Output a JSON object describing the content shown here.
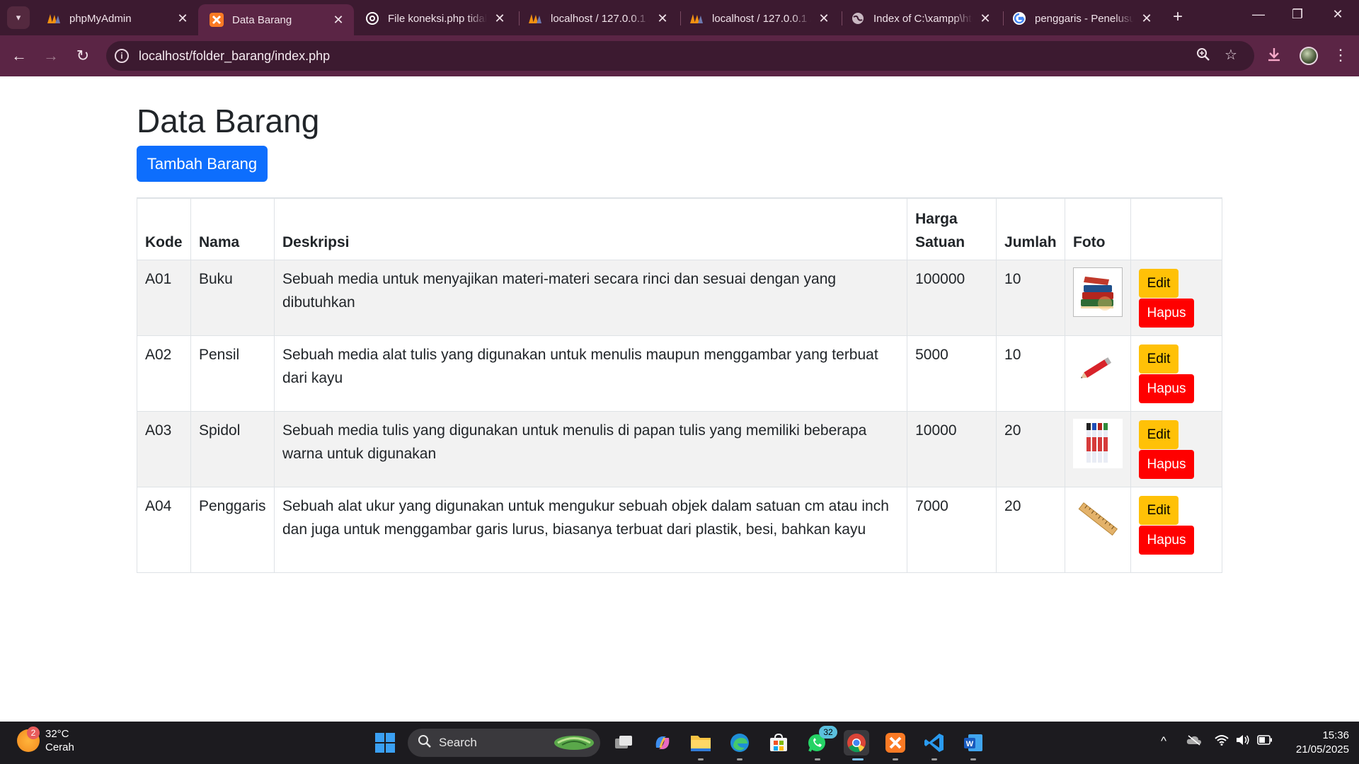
{
  "browser": {
    "tabs": [
      {
        "title": "phpMyAdmin",
        "favicon": "phpmyadmin-icon",
        "active": false
      },
      {
        "title": "Data Barang",
        "favicon": "xampp-icon",
        "active": true
      },
      {
        "title": "File koneksi.php tidak",
        "favicon": "chatgpt-icon",
        "active": false
      },
      {
        "title": "localhost / 127.0.0.1 /",
        "favicon": "phpmyadmin-icon",
        "active": false
      },
      {
        "title": "localhost / 127.0.0.1 /",
        "favicon": "phpmyadmin-icon",
        "active": false
      },
      {
        "title": "Index of C:\\xampp\\htd",
        "favicon": "globe-icon",
        "active": false
      },
      {
        "title": "penggaris - Penelusur",
        "favicon": "google-icon",
        "active": false
      }
    ],
    "url": "localhost/folder_barang/index.php"
  },
  "page": {
    "title": "Data Barang",
    "add_button": "Tambah Barang",
    "table": {
      "headers": {
        "kode": "Kode",
        "nama": "Nama",
        "deskripsi": "Deskripsi",
        "harga_line1": "Harga",
        "harga_line2": "Satuan",
        "jumlah": "Jumlah",
        "foto": "Foto"
      },
      "rows": [
        {
          "kode": "A01",
          "nama": "Buku",
          "deskripsi": "Sebuah media untuk menyajikan materi-materi secara rinci dan sesuai dengan yang dibutuhkan",
          "harga": "100000",
          "jumlah": "10",
          "foto": "books-image"
        },
        {
          "kode": "A02",
          "nama": "Pensil",
          "deskripsi": "Sebuah media alat tulis yang digunakan untuk menulis maupun menggambar yang terbuat dari kayu",
          "harga": "5000",
          "jumlah": "10",
          "foto": "pencil-image"
        },
        {
          "kode": "A03",
          "nama": "Spidol",
          "deskripsi": "Sebuah media tulis yang digunakan untuk menulis di papan tulis yang memiliki beberapa warna untuk digunakan",
          "harga": "10000",
          "jumlah": "20",
          "foto": "markers-image"
        },
        {
          "kode": "A04",
          "nama": "Penggaris",
          "deskripsi": "Sebuah alat ukur yang digunakan untuk mengukur sebuah objek dalam satuan cm atau inch dan juga untuk menggambar garis lurus, biasanya terbuat dari plastik, besi, bahkan kayu",
          "harga": "7000",
          "jumlah": "20",
          "foto": "ruler-image"
        }
      ],
      "edit_label": "Edit",
      "delete_label": "Hapus"
    }
  },
  "taskbar": {
    "weather_temp": "32°C",
    "weather_desc": "Cerah",
    "weather_badge": "2",
    "search_label": "Search",
    "whatsapp_badge": "32",
    "time": "15:36",
    "date": "21/05/2025"
  },
  "colors": {
    "primary": "#0d6efd",
    "warning": "#ffc107",
    "danger": "#ff0000",
    "browser_frame": "#5b2545"
  }
}
